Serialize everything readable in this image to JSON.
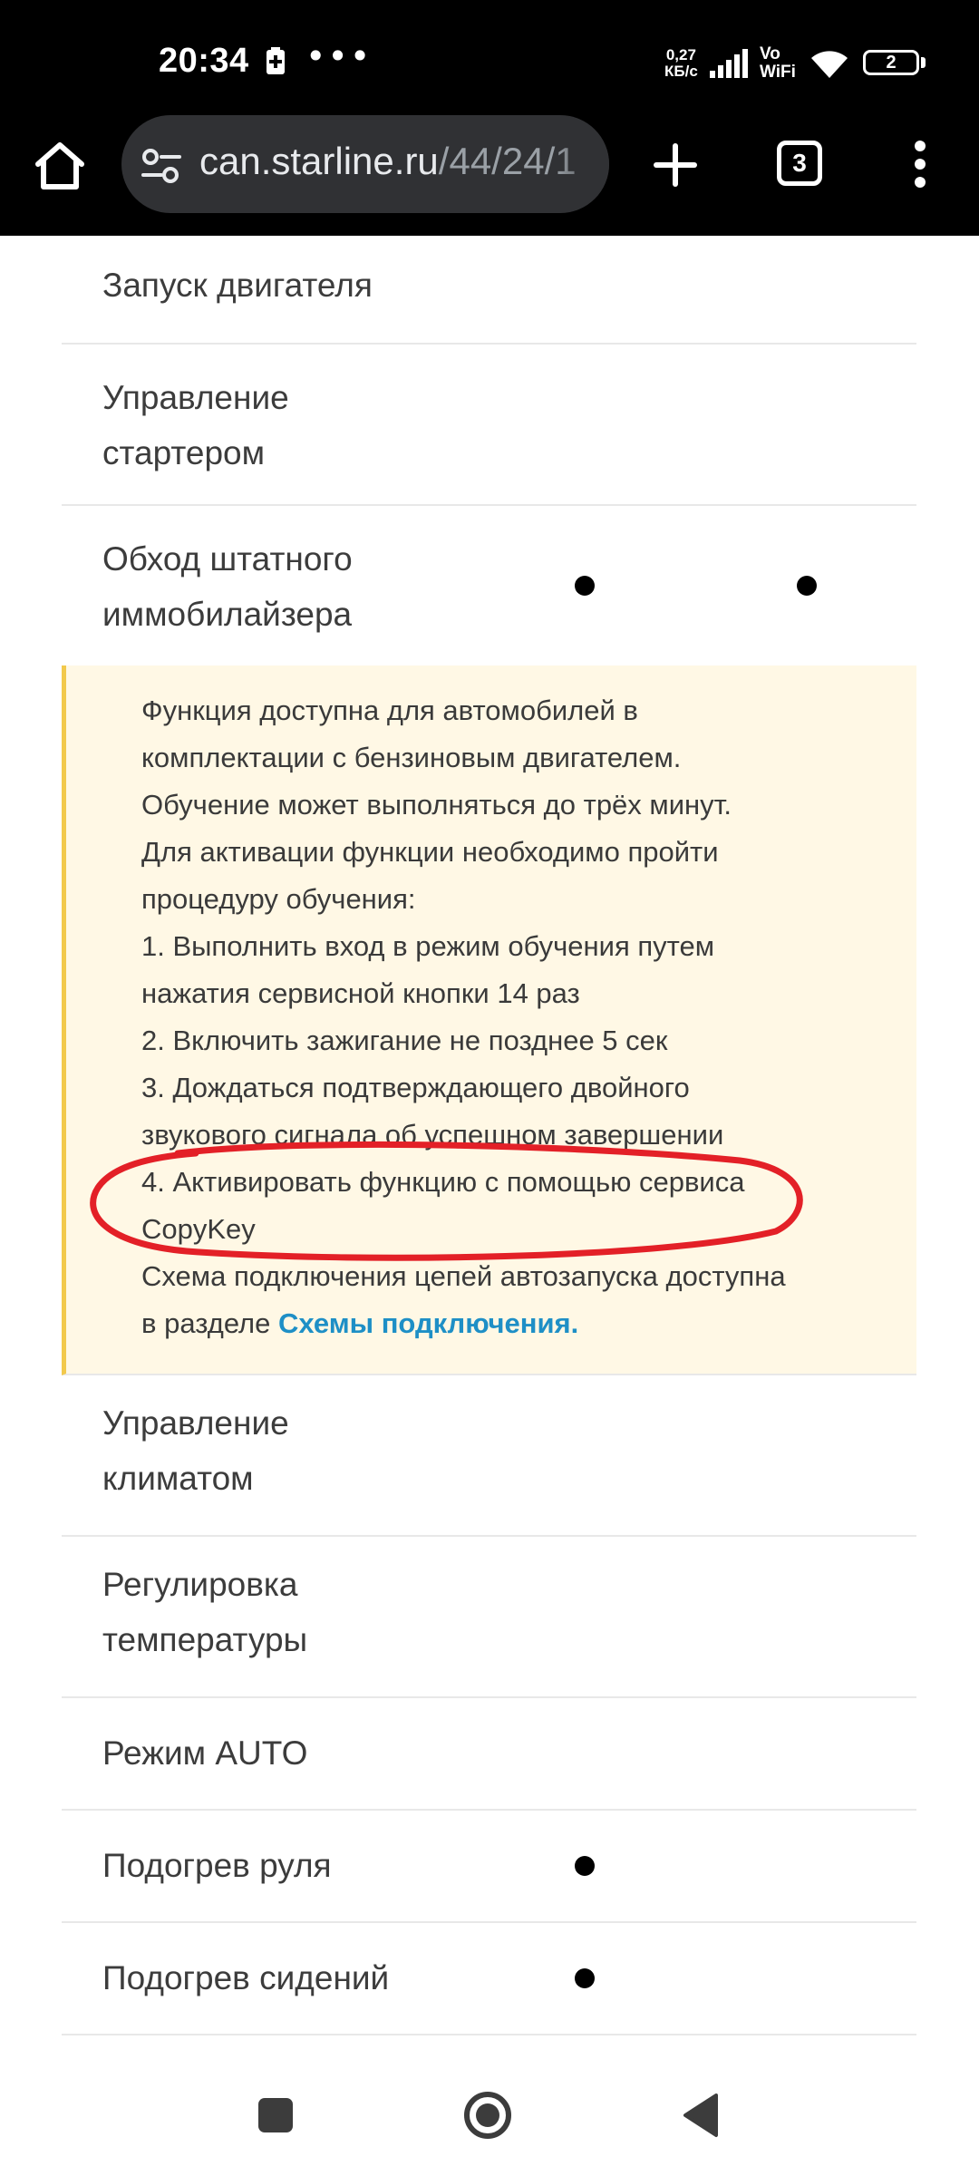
{
  "status_bar": {
    "time": "20:34",
    "dots": "•••",
    "net_speed_value": "0,27",
    "net_speed_unit": "КБ/с",
    "vowifi_top": "Vo",
    "vowifi_bottom": "WiFi",
    "battery": "2"
  },
  "browser": {
    "url_host": "can.starline.ru",
    "url_path": "/44/24/1",
    "tab_count": "3"
  },
  "rows_top": [
    {
      "label": "Запуск двигателя"
    },
    {
      "label_line1": "Управление",
      "label_line2": "стартером"
    },
    {
      "label_line1": "Обход штатного",
      "label_line2": "иммобилайзера"
    }
  ],
  "note": {
    "lines": [
      "Функция доступна для автомобилей в",
      "комплектации с бензиновым двигателем.",
      "Обучение может выполняться до трёх минут.",
      "Для активации функции необходимо пройти",
      "процедуру обучения:",
      "1. Выполнить вход в режим обучения путем",
      "нажатия сервисной кнопки 14 раз",
      "2. Включить зажигание не позднее 5 сек",
      "3. Дождаться подтверждающего двойного",
      "звукового сигнала об успешном завершении",
      "4. Активировать функцию с помощью сервиса",
      "CopyKey",
      "Схема подключения цепей автозапуска доступна"
    ],
    "last_line_prefix": "в разделе ",
    "link_text": "Схемы подключения."
  },
  "rows_bottom": [
    {
      "label_line1": "Управление",
      "label_line2": "климатом"
    },
    {
      "label_line1": "Регулировка",
      "label_line2": "температуры"
    },
    {
      "label": "Режим AUTO"
    },
    {
      "label": "Подогрев руля"
    },
    {
      "label": "Подогрев сидений"
    }
  ],
  "colors": {
    "note_background": "#fff8e5",
    "note_border": "#f2c94c",
    "link": "#1e8fc6",
    "annotation": "#e32027"
  },
  "icons": [
    "battery-saver-icon",
    "signal-icon",
    "wifi-icon",
    "home-icon",
    "site-settings-icon",
    "plus-icon",
    "more-vert-icon",
    "recents-icon",
    "nav-home-icon",
    "back-icon"
  ]
}
